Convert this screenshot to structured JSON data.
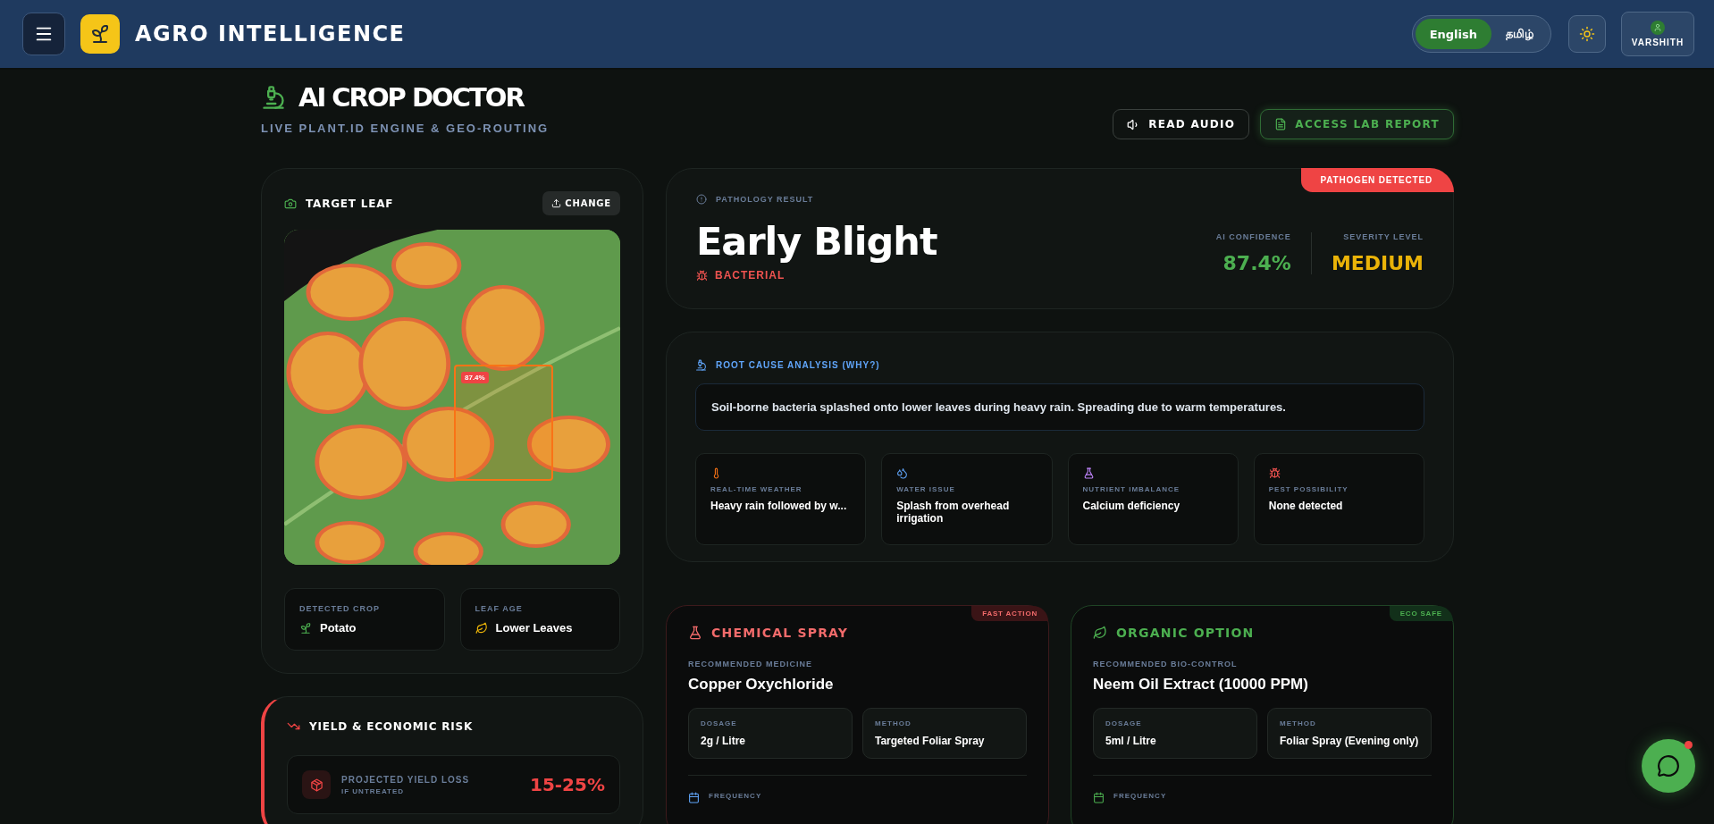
{
  "header": {
    "brand": "AGRO INTELLIGENCE",
    "languages": [
      {
        "label": "English",
        "selected": true
      },
      {
        "label": "தமிழ்",
        "selected": false
      }
    ],
    "user": "VARSHITH"
  },
  "page": {
    "title": "AI CROP DOCTOR",
    "subtitle": "LIVE PLANT.ID ENGINE & GEO-ROUTING",
    "actions": [
      {
        "label": "READ AUDIO",
        "kind": "audio"
      },
      {
        "label": "ACCESS LAB REPORT",
        "kind": "report"
      }
    ]
  },
  "target_leaf": {
    "title": "TARGET LEAF",
    "change": "CHANGE",
    "detection_label": "87.4%",
    "facts": [
      {
        "kind": "crop",
        "label": "DETECTED CROP",
        "value": "Potato"
      },
      {
        "kind": "age",
        "label": "LEAF AGE",
        "value": "Lower Leaves"
      }
    ]
  },
  "yield_risk": {
    "title": "YIELD & ECONOMIC RISK",
    "label": "PROJECTED YIELD LOSS",
    "note": "IF UNTREATED",
    "value": "15-25%"
  },
  "result": {
    "badge": "PATHOGEN DETECTED",
    "label": "PATHOLOGY RESULT",
    "disease": "Early Blight",
    "type": "BACTERIAL",
    "stats": [
      {
        "label": "AI CONFIDENCE",
        "value": "87.4%",
        "color": "#4caf50"
      },
      {
        "label": "SEVERITY LEVEL",
        "value": "MEDIUM",
        "color": "#eab308"
      }
    ]
  },
  "root_cause": {
    "title": "ROOT CAUSE ANALYSIS (WHY?)",
    "summary": "Soil-borne bacteria splashed onto lower leaves during heavy rain. Spreading due to warm temperatures.",
    "factors": [
      {
        "kind": "weather",
        "label": "REAL-TIME WEATHER",
        "value": "Heavy rain followed by w..."
      },
      {
        "kind": "water",
        "label": "WATER ISSUE",
        "value": "Splash from overhead irrigation"
      },
      {
        "kind": "nutrient",
        "label": "NUTRIENT IMBALANCE",
        "value": "Calcium deficiency"
      },
      {
        "kind": "pest",
        "label": "PEST POSSIBILITY",
        "value": "None detected"
      }
    ]
  },
  "treatments": [
    {
      "kind": "chemical",
      "title": "CHEMICAL SPRAY",
      "badge": "FAST ACTION",
      "product_label": "RECOMMENDED MEDICINE",
      "product": "Copper Oxychloride",
      "details": [
        {
          "label": "DOSAGE",
          "value": "2g / Litre"
        },
        {
          "label": "METHOD",
          "value": "Targeted Foliar Spray"
        }
      ],
      "schedule_label": "FREQUENCY"
    },
    {
      "kind": "organic",
      "title": "ORGANIC OPTION",
      "badge": "ECO SAFE",
      "product_label": "RECOMMENDED BIO-CONTROL",
      "product": "Neem Oil Extract (10000 PPM)",
      "details": [
        {
          "label": "DOSAGE",
          "value": "5ml / Litre"
        },
        {
          "label": "METHOD",
          "value": "Foliar Spray (Evening only)"
        }
      ],
      "schedule_label": "FREQUENCY"
    }
  ],
  "chat": {
    "unread": true
  }
}
